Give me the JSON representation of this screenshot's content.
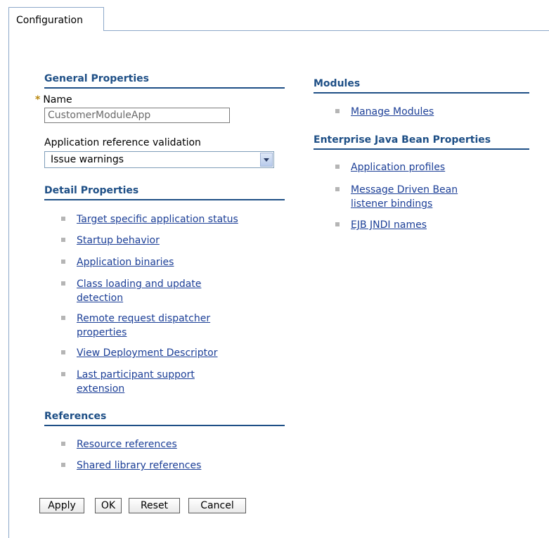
{
  "tabs": [
    {
      "label": "Configuration"
    }
  ],
  "general_properties": {
    "title": "General Properties",
    "name_label": "Name",
    "name_value": "CustomerModuleApp",
    "validation_label": "Application reference validation",
    "validation_value": "Issue warnings"
  },
  "detail_properties": {
    "title": "Detail Properties",
    "items": [
      {
        "line1": "Target specific application status",
        "line2": ""
      },
      {
        "line1": "Startup behavior",
        "line2": ""
      },
      {
        "line1": "Application binaries",
        "line2": ""
      },
      {
        "line1": "Class loading and update",
        "line2": "detection"
      },
      {
        "line1": "Remote request dispatcher",
        "line2": "properties"
      },
      {
        "line1": "View Deployment Descriptor",
        "line2": ""
      },
      {
        "line1": "Last participant support",
        "line2": "extension"
      }
    ]
  },
  "references": {
    "title": "References",
    "items": [
      {
        "line1": "Resource references"
      },
      {
        "line1": "Shared library references"
      }
    ]
  },
  "modules": {
    "title": "Modules",
    "items": [
      {
        "line1": "Manage Modules"
      }
    ]
  },
  "ejb_properties": {
    "title": "Enterprise Java Bean Properties",
    "items": [
      {
        "line1": "Application profiles",
        "line2": ""
      },
      {
        "line1": "Message Driven Bean",
        "line2": "listener bindings"
      },
      {
        "line1": "EJB JNDI names",
        "line2": ""
      }
    ]
  },
  "buttons": {
    "apply": "Apply",
    "ok": "OK",
    "reset": "Reset",
    "cancel": "Cancel"
  },
  "colors": {
    "heading": "#1e4f86",
    "link": "#1c3f97",
    "tab_border": "#8da8c9",
    "required_star": "#b8860b"
  },
  "icons": {
    "list_bullet": "square-bullet-icon",
    "dropdown": "chevron-down-icon",
    "required": "required-star-icon"
  }
}
